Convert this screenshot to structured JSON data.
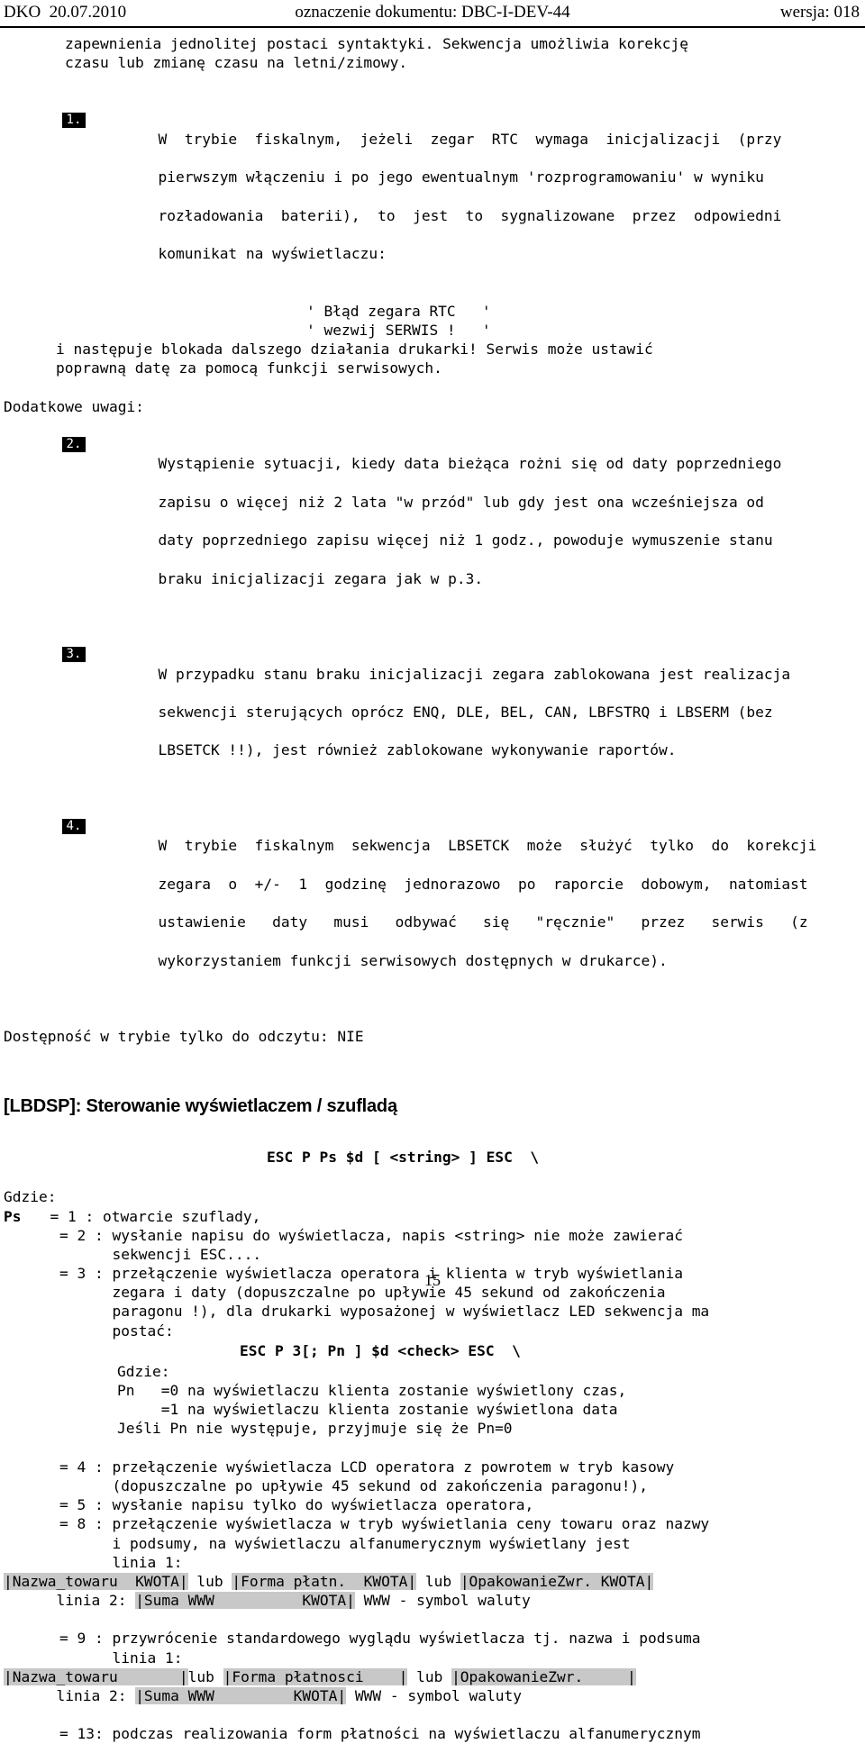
{
  "header": {
    "left": "DKO  20.07.2010",
    "center": "oznaczenie dokumentu: DBC-I-DEV-44",
    "right": "wersja: 018"
  },
  "intro": {
    "line1": "zapewnienia jednolitej postaci syntaktyki. Sekwencja umożliwia korekcję",
    "line2": "czasu lub zmianę czasu na letni/zimowy."
  },
  "item1": {
    "marker": "1.",
    "lines": [
      "W  trybie  fiskalnym,  jeżeli  zegar  RTC  wymaga  inicjalizacji  (przy",
      "pierwszym włączeniu i po jego ewentualnym 'rozprogramowaniu' w wyniku",
      "rozładowania  baterii),  to  jest  to  sygnalizowane  przez  odpowiedni",
      "komunikat na wyświetlaczu:"
    ],
    "display_line1": "' Błąd zegara RTC   '",
    "display_line2": "' wezwij SERWIS !   '",
    "after": [
      "i następuje blokada dalszego działania drukarki! Serwis może ustawić",
      "poprawną datę za pomocą funkcji serwisowych."
    ]
  },
  "notes_label": "Dodatkowe uwagi:",
  "item2": {
    "marker": "2.",
    "lines": [
      "Wystąpienie sytuacji, kiedy data bieżąca rożni się od daty poprzedniego",
      "zapisu o więcej niż 2 lata \"w przód\" lub gdy jest ona wcześniejsza od",
      "daty poprzedniego zapisu więcej niż 1 godz., powoduje wymuszenie stanu",
      "braku inicjalizacji zegara jak w p.3."
    ]
  },
  "item3": {
    "marker": "3.",
    "lines": [
      "W przypadku stanu braku inicjalizacji zegara zablokowana jest realizacja",
      "sekwencji sterujących oprócz ENQ, DLE, BEL, CAN, LBFSTRQ i LBSERM (bez",
      "LBSETCK !!), jest również zablokowane wykonywanie raportów."
    ]
  },
  "item4": {
    "marker": "4.",
    "lines": [
      "W  trybie  fiskalnym  sekwencja  LBSETCK  może  służyć  tylko  do  korekcji",
      "zegara  o  +/-  1  godzinę  jednorazowo  po  raporcie  dobowym,  natomiast",
      "ustawienie   daty   musi   odbywać   się   \"ręcznie\"   przez   serwis   (z",
      "wykorzystaniem funkcji serwisowych dostępnych w drukarce)."
    ]
  },
  "availability": "Dostępność w trybie tylko do odczytu: NIE",
  "section": {
    "heading": "[LBDSP]: Sterowanie wyświetlaczem / szufladą",
    "sequence": "ESC P Ps $d [ <string> ] ESC  \\",
    "gdzie_label": "Gdzie:",
    "ps_label": "Ps",
    "ps_options": [
      {
        "text": "= 1 : otwarcie szuflady,"
      },
      {
        "text": "= 2 : wysłanie napisu do wyświetlacza, napis <string> nie może zawierać"
      },
      {
        "text": "      sekwencji ESC...."
      },
      {
        "text": "= 3 : przełączenie wyświetlacza operatora i klienta w tryb wyświetlania"
      },
      {
        "text": "      zegara i daty (dopuszczalne po upływie 45 sekund od zakończenia"
      },
      {
        "text": "      paragonu !), dla drukarki wyposażonej w wyświetlacz LED sekwencja ma"
      },
      {
        "text": "      postać:"
      }
    ],
    "sequence2": "ESC P 3[; Pn ] $d <check> ESC  \\",
    "gdzie2_label": "Gdzie:",
    "pn_label": "Pn",
    "pn_lines": [
      "Pn   =0 na wyświetlaczu klienta zostanie wyświetlony czas,",
      "     =1 na wyświetlaczu klienta zostanie wyświetlona data",
      "Jeśli Pn nie występuje, przyjmuje się że Pn=0"
    ],
    "ps_options2": [
      {
        "text": "= 4 : przełączenie wyświetlacza LCD operatora z powrotem w tryb kasowy"
      },
      {
        "text": "      (dopuszczalne po upływie 45 sekund od zakończenia paragonu!),"
      },
      {
        "text": "= 5 : wysłanie napisu tylko do wyświetlacza operatora,"
      },
      {
        "text": "= 8 : przełączenie wyświetlacza w tryb wyświetlania ceny towaru oraz nazwy"
      },
      {
        "text": "      i podsumy, na wyświetlaczu alfanumerycznym wyświetlany jest"
      },
      {
        "text": "      linia 1:"
      }
    ],
    "display8": {
      "field1": "|Nazwa_towaru  KWOTA|",
      "or1": " lub ",
      "field2": "|Forma płatn.  KWOTA|",
      "or2": " lub ",
      "field3": "|OpakowanieZwr. KWOTA|",
      "line2_label": "      linia 2: ",
      "line2_field": "|Suma WWW          KWOTA|",
      "line2_note": " WWW - symbol waluty"
    },
    "ps_options3": [
      {
        "text": "= 9 : przywrócenie standardowego wyglądu wyświetlacza tj. nazwa i podsuma"
      },
      {
        "text": "      linia 1:"
      }
    ],
    "display9": {
      "field1": "|Nazwa_towaru       |",
      "or1": "lub ",
      "field2": "|Forma płatnosci    |",
      "or2": " lub ",
      "field3": "|OpakowanieZwr.     |",
      "line2_label": "      linia 2: ",
      "line2_field": "|Suma WWW         KWOTA|",
      "line2_note": " WWW - symbol waluty"
    },
    "ps_option13": "= 13: podczas realizowania form płatności na wyświetlaczu alfanumerycznym"
  },
  "footer": {
    "page_number": "15"
  }
}
